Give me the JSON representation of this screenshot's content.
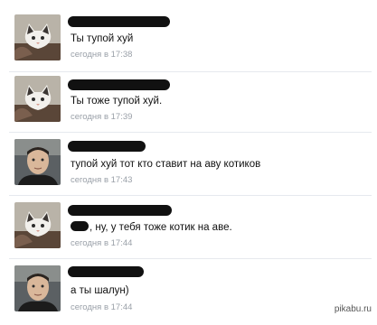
{
  "messages": [
    {
      "avatar": "cat-icon",
      "text": "Ты тупой хуй",
      "time": "сегодня в 17:38"
    },
    {
      "avatar": "cat-icon",
      "text": "Ты тоже тупой хуй.",
      "time": "сегодня в 17:39"
    },
    {
      "avatar": "man-photo",
      "text": "тупой хуй тот кто ставит на аву котиков",
      "time": "сегодня в 17:43"
    },
    {
      "avatar": "cat-icon",
      "text": ", ну, у тебя тоже котик на аве.",
      "time": "сегодня в 17:44"
    },
    {
      "avatar": "man-photo",
      "text": "а ты шалун)",
      "time": "сегодня в 17:44"
    }
  ],
  "watermark": "pikabu.ru"
}
